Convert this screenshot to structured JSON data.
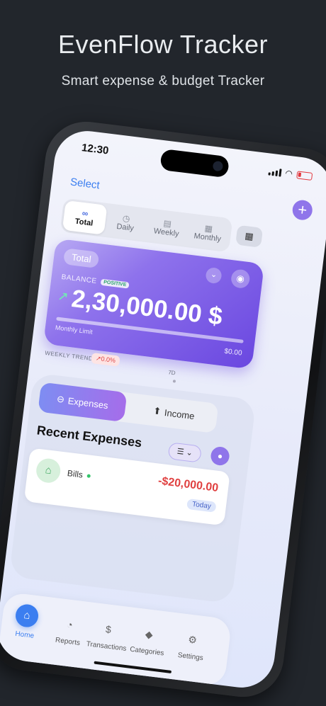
{
  "hero": {
    "title": "EvenFlow Tracker",
    "subtitle": "Smart expense & budget Tracker"
  },
  "status_bar": {
    "time": "12:30"
  },
  "header": {
    "select_label": "Select",
    "add_icon": "plus-icon"
  },
  "period_tabs": [
    {
      "label": "Total",
      "icon": "infinity-icon",
      "active": true
    },
    {
      "label": "Daily",
      "icon": "clock-icon",
      "active": false
    },
    {
      "label": "Weekly",
      "icon": "calendar-week-icon",
      "active": false
    },
    {
      "label": "Monthly",
      "icon": "calendar-month-icon",
      "active": false
    }
  ],
  "balance_card": {
    "scope_label": "Total",
    "balance_label": "BALANCE",
    "status_badge": "POSITIVE",
    "amount": "2,30,000.00 $",
    "monthly_limit_label": "Monthly Limit",
    "monthly_limit_value": "$0.00",
    "colors": {
      "start": "#b7a8f3",
      "end": "#6a47e0"
    }
  },
  "trend": {
    "label": "WEEKLY TREND",
    "change": "↗0.0%",
    "range": "7D"
  },
  "transaction_tabs": {
    "expenses_label": "Expenses",
    "income_label": "Income",
    "active": "Expenses"
  },
  "recent": {
    "title": "Recent Expenses",
    "items": [
      {
        "category": "Bills",
        "amount": "-$20,000.00",
        "date_badge": "Today",
        "icon": "home-icon"
      }
    ]
  },
  "bottom_nav": [
    {
      "label": "Home",
      "icon": "home-icon",
      "active": true
    },
    {
      "label": "Reports",
      "icon": "pie-chart-icon",
      "active": false
    },
    {
      "label": "Transactions",
      "icon": "dollar-icon",
      "active": false
    },
    {
      "label": "Categories",
      "icon": "tag-icon",
      "active": false
    },
    {
      "label": "Settings",
      "icon": "gear-icon",
      "active": false
    }
  ],
  "accent_colors": {
    "primary": "#3b7ef0",
    "purple": "#8f75ea",
    "expense_red": "#e04040"
  }
}
